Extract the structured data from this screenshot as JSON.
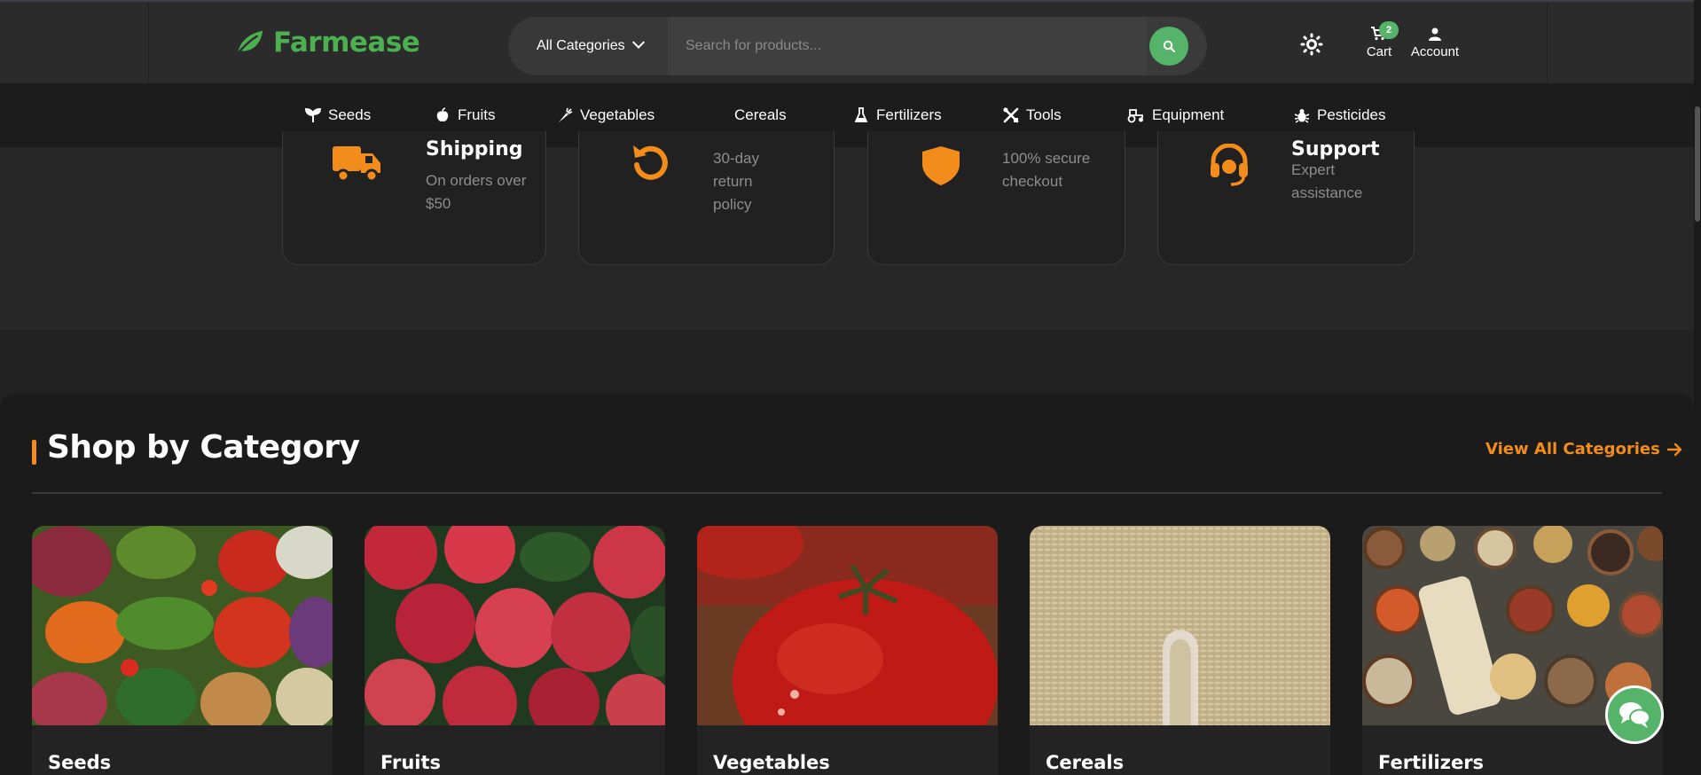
{
  "brand": {
    "name": "Farmease",
    "accent": "#4caf50",
    "orange": "#f28c1b"
  },
  "search": {
    "category": "All Categories",
    "placeholder": "Search for products..."
  },
  "header": {
    "cart_label": "Cart",
    "cart_count": "2",
    "account_label": "Account"
  },
  "nav": [
    {
      "label": "Seeds",
      "icon": "seedling-icon"
    },
    {
      "label": "Fruits",
      "icon": "apple-icon"
    },
    {
      "label": "Vegetables",
      "icon": "carrot-icon"
    },
    {
      "label": "Cereals",
      "icon": ""
    },
    {
      "label": "Fertilizers",
      "icon": "flask-icon"
    },
    {
      "label": "Tools",
      "icon": "tools-icon"
    },
    {
      "label": "Equipment",
      "icon": "tractor-icon"
    },
    {
      "label": "Pesticides",
      "icon": "bug-icon"
    }
  ],
  "features": [
    {
      "title": "Shipping",
      "desc": "On orders over $50",
      "icon": "truck-icon"
    },
    {
      "title": "",
      "desc": "30-day return policy",
      "icon": "undo-icon"
    },
    {
      "title": "",
      "desc": "100% secure checkout",
      "icon": "shield-icon"
    },
    {
      "title": "Support",
      "desc": "Expert assistance",
      "icon": "headset-icon"
    }
  ],
  "categories_section": {
    "title": "Shop by Category",
    "view_all": "View All Categories",
    "items": [
      {
        "name": "Seeds"
      },
      {
        "name": "Fruits"
      },
      {
        "name": "Vegetables"
      },
      {
        "name": "Cereals"
      },
      {
        "name": "Fertilizers"
      }
    ]
  }
}
